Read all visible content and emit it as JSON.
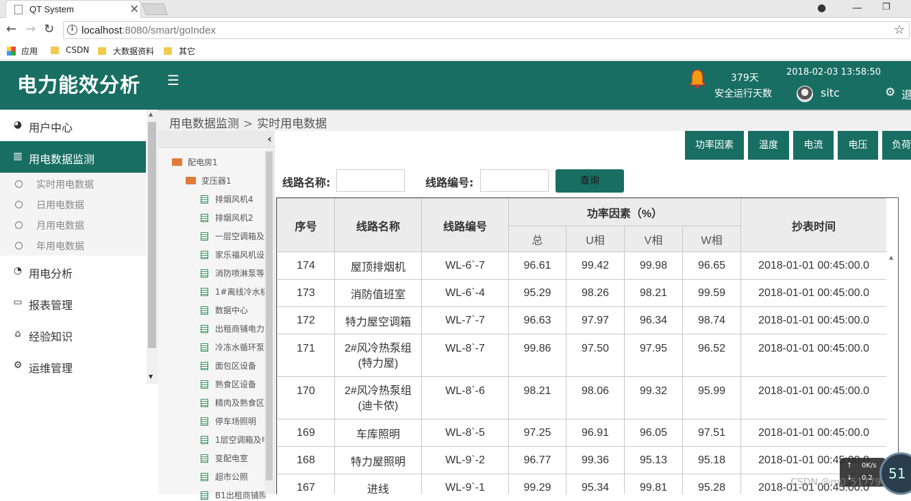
{
  "browser": {
    "tab_title": "QT System",
    "url_host": "localhost",
    "url_rest": ":8080/smart/goIndex",
    "bookmarks": [
      "应用",
      "CSDN",
      "大数据资料",
      "其它"
    ]
  },
  "header": {
    "logo": "电力能效分析",
    "days": "379天",
    "days_label": "安全运行天数",
    "datetime": "2018-02-03 13:58:50",
    "username": "sitc",
    "logout": "退"
  },
  "sidebar": {
    "items": [
      {
        "label": "用户中心",
        "icon": "dashboard-icon"
      },
      {
        "label": "用电数据监测",
        "icon": "bar-chart-icon"
      },
      {
        "label": "用电分析",
        "icon": "pie-chart-icon"
      },
      {
        "label": "报表管理",
        "icon": "laptop-icon"
      },
      {
        "label": "经验知识",
        "icon": "home-icon"
      },
      {
        "label": "运维管理",
        "icon": "gear-icon"
      }
    ],
    "subitems": [
      "实时用电数据",
      "日用电数据",
      "月用电数据",
      "年用电数据"
    ]
  },
  "breadcrumb": {
    "parent": "用电数据监测",
    "sep": ">",
    "current": "实时用电数据"
  },
  "tree": {
    "root": "配电房1",
    "child": "变压器1",
    "leaves": [
      "排烟风机4",
      "排烟风机2",
      "一层空调箱及",
      "家乐福风机设",
      "消防喷淋泵等",
      "1#离线冷水机",
      "数据中心",
      "出租商铺电力",
      "冷冻水循环泵",
      "面包区设备",
      "熟食区设备",
      "精肉及熟食区",
      "停车场照明",
      "1层空调箱及申",
      "变配电室",
      "超市公照",
      "B1出租商铺照"
    ]
  },
  "tabs": [
    "功率因素",
    "温度",
    "电流",
    "电压",
    "负荷"
  ],
  "search": {
    "name_label": "线路名称:",
    "code_label": "线路编号:",
    "button": "查询"
  },
  "table": {
    "headers": {
      "seq": "序号",
      "name": "线路名称",
      "code": "线路编号",
      "group": "功率因素（%）",
      "total": "总",
      "u": "U相",
      "v": "V相",
      "w": "W相",
      "time": "抄表时间"
    },
    "rows": [
      {
        "seq": "174",
        "name": "屋顶排烟机",
        "code": "WL-6`-7",
        "total": "96.61",
        "u": "99.42",
        "v": "99.98",
        "w": "96.65",
        "time": "2018-01-01 00:45:00.0"
      },
      {
        "seq": "173",
        "name": "消防值班室",
        "code": "WL-6`-4",
        "total": "95.29",
        "u": "98.26",
        "v": "98.21",
        "w": "99.59",
        "time": "2018-01-01 00:45:00.0"
      },
      {
        "seq": "172",
        "name": "特力屋空调箱",
        "code": "WL-7`-7",
        "total": "96.63",
        "u": "97.97",
        "v": "96.34",
        "w": "98.74",
        "time": "2018-01-01 00:45:00.0"
      },
      {
        "seq": "171",
        "name": "2#风冷热泵组\n(特力屋)",
        "code": "WL-8`-7",
        "total": "99.86",
        "u": "97.50",
        "v": "97.95",
        "w": "96.52",
        "time": "2018-01-01 00:45:00.0"
      },
      {
        "seq": "170",
        "name": "2#风冷热泵组\n(迪卡侬)",
        "code": "WL-8`-6",
        "total": "98.21",
        "u": "98.06",
        "v": "99.32",
        "w": "95.99",
        "time": "2018-01-01 00:45:00.0"
      },
      {
        "seq": "169",
        "name": "车库照明",
        "code": "WL-8`-5",
        "total": "97.25",
        "u": "96.91",
        "v": "96.05",
        "w": "97.51",
        "time": "2018-01-01 00:45:00.0"
      },
      {
        "seq": "168",
        "name": "特力屋照明",
        "code": "WL-9`-2",
        "total": "96.77",
        "u": "99.36",
        "v": "95.13",
        "w": "95.18",
        "time": "2018-01-01 00:45:00.0"
      },
      {
        "seq": "167",
        "name": "进线",
        "code": "WL-9`-1",
        "total": "99.29",
        "u": "95.34",
        "v": "99.81",
        "w": "95.28",
        "time": "2018-01-01 00:45:00.0"
      }
    ]
  },
  "overlay": {
    "speed": "0K/s",
    "speed2": "0.2",
    "percent": "51",
    "watermark": "CSDN @m0_51779145"
  },
  "colors": {
    "brand": "#196e63"
  }
}
